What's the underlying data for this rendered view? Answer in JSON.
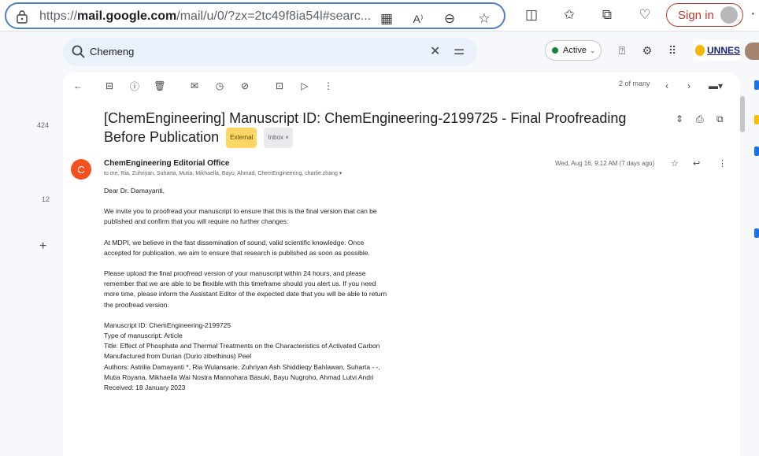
{
  "browser": {
    "url_scheme": "https://",
    "url_host": "mail.google.com",
    "url_rest": "/mail/u/0/?zx=2tc49f8ia54l#searc...",
    "signin_label": "Sign in",
    "icons": [
      "lock-icon",
      "qr-icon",
      "read-aloud-icon",
      "zoom-out-icon",
      "favorite-icon",
      "split-screen-icon",
      "favorites-list-icon",
      "collections-icon",
      "browser-essentials-icon",
      "more-icon"
    ]
  },
  "gmail": {
    "search_value": "Chemeng",
    "status_label": "Active",
    "status_color": "#188038",
    "org_logo_text": "UNNES"
  },
  "rail": {
    "count_top": "424",
    "count_second": "12",
    "plus_label": "+"
  },
  "toolbar": {
    "paging": "2 of many"
  },
  "email": {
    "subject": "[ChemEngineering] Manuscript ID: ChemEngineering-2199725 - Final Proofreading Before Publication",
    "tag_external": "External",
    "tag_inbox": "Inbox ×",
    "sender_initial": "C",
    "sender_avatar_color": "#f4511e",
    "sender_name": "ChemEngineering Editorial Office",
    "recipients": "to me, Ria, Zuhriyan, Suharta, Mutia, Mikhaella, Bayu, Ahmad, ChemEngineering, charlie.zhang ▾",
    "date": "Wed, Aug 16, 9:12 AM (7 days ago)",
    "greeting": "Dear Dr. Damayanti,",
    "para1": "We invite you to proofread your manuscript to ensure that this is the final version that can be published and confirm that you will require no further changes:",
    "para2": "At MDPI, we believe in the fast dissemination of sound, valid scientific knowledge. Once accepted for publication, we aim to ensure that research is published as soon as possible.",
    "para3": "Please upload the final proofread version of your manuscript within 24 hours, and please remember that we are able to be flexible with this timeframe should you alert us. If you need more time, please inform the Assistant Editor of the expected date that you will be able to return the proofread version.",
    "manuscript_id": "Manuscript ID: ChemEngineering-2199725",
    "manuscript_type": "Type of manuscript: Article",
    "title": "Title: Effect of Phosphate and Thermal Treatments on the Characteristics of Activated Carbon Manufactured from Durian (Durio zibethinus) Peel",
    "authors": "Authors: Astrilia Damayanti *, Ria Wulansarie, Zuhriyan Ash Shiddieqy Bahlawan, Suharta - -, Mutia Royana, Mikhaella Wai Nostra Mannohara Basuki, Bayu Nugroho, Ahmad Lutvi Andri",
    "received": "Received: 18 January 2023"
  }
}
